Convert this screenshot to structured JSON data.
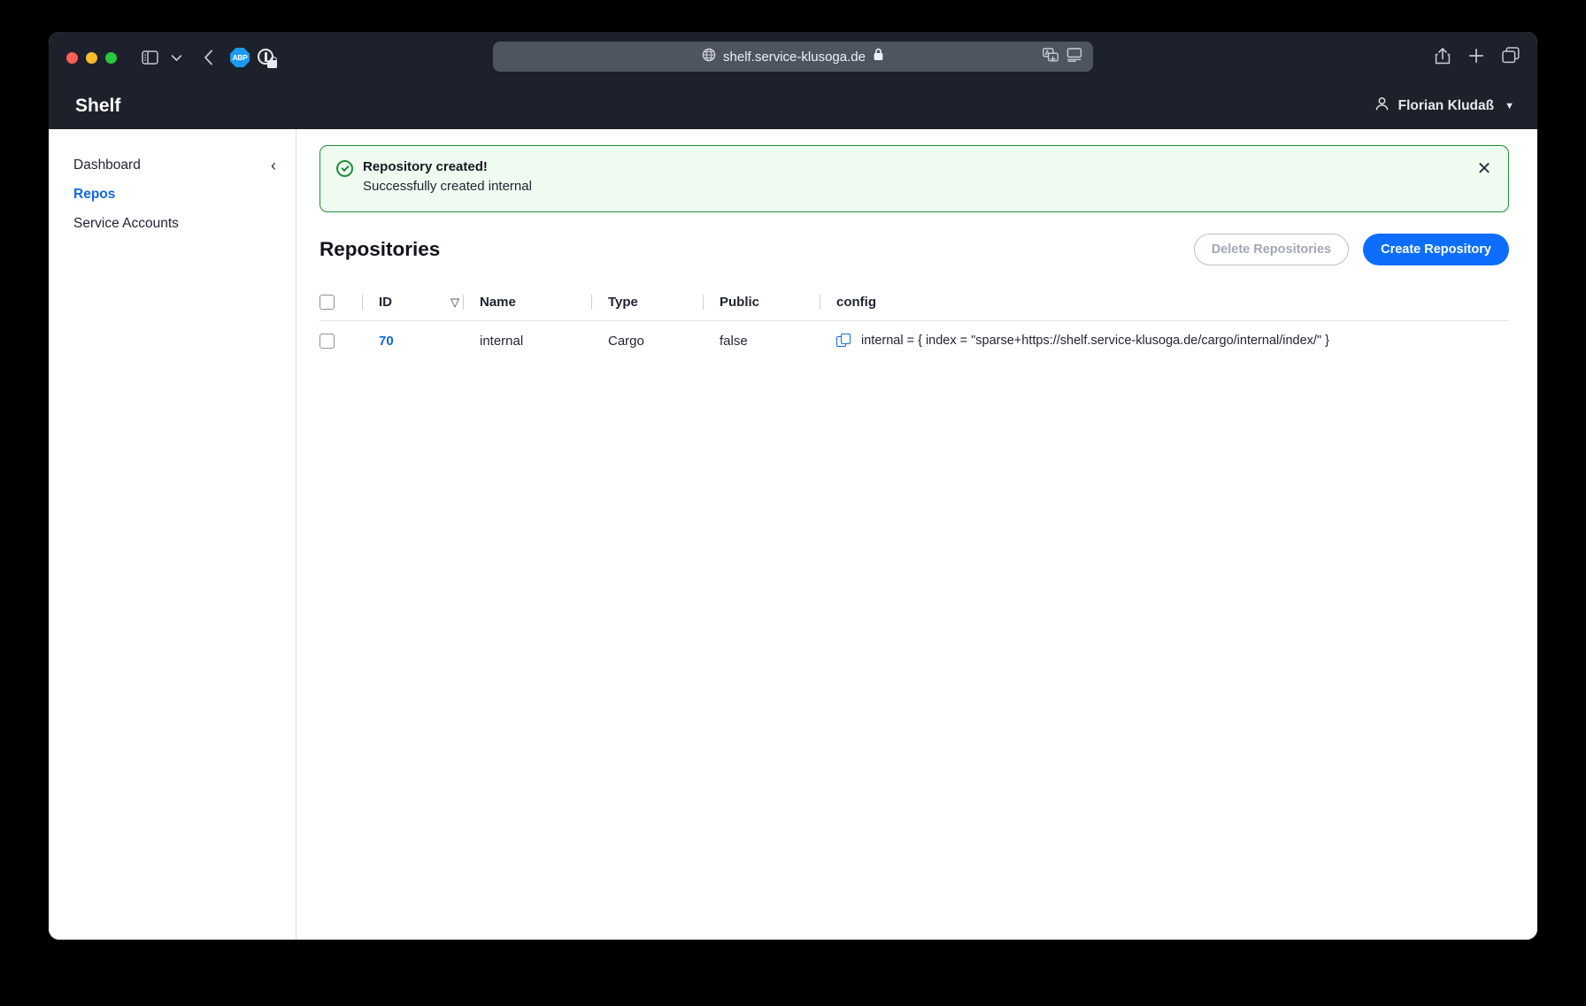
{
  "browser": {
    "url": "shelf.service-klusoga.de",
    "globe_icon": "globe-icon",
    "lock_icon": "lock-icon",
    "translate_icon": "translate-icon",
    "reader_icon": "reader-view-icon",
    "sidebar_toggle_icon": "sidebar-toggle-icon",
    "chevron_down_icon": "chevron-down-icon",
    "back_icon": "back-arrow-icon",
    "abp_label": "ABP",
    "privacy_icon": "privacy-shield-icon",
    "share_icon": "share-icon",
    "new_tab_icon": "plus-icon",
    "tabs_icon": "tab-overview-icon"
  },
  "app": {
    "title": "Shelf",
    "user": {
      "name": "Florian Kludaß",
      "avatar_icon": "person-icon",
      "caret": "▼"
    }
  },
  "sidebar": {
    "collapse_icon": "‹",
    "items": [
      {
        "label": "Dashboard",
        "active": false
      },
      {
        "label": "Repos",
        "active": true
      },
      {
        "label": "Service Accounts",
        "active": false
      }
    ]
  },
  "alert": {
    "icon": "check-circle-icon",
    "title": "Repository created!",
    "message": "Successfully created internal",
    "close_icon": "✕",
    "border_color": "#1f8f38",
    "background_color": "#effbf1"
  },
  "page": {
    "title": "Repositories",
    "delete_button": "Delete Repositories",
    "create_button": "Create Repository",
    "create_button_color": "#0d6efd"
  },
  "table": {
    "columns": [
      "ID",
      "Name",
      "Type",
      "Public",
      "config"
    ],
    "sort_icon": "▽",
    "sort_column": "ID",
    "rows": [
      {
        "id": "70",
        "name": "internal",
        "type": "Cargo",
        "public": "false",
        "config": "internal = { index = \"sparse+https://shelf.service-klusoga.de/cargo/internal/index/\" }",
        "copy_icon": "copy-icon"
      }
    ]
  }
}
